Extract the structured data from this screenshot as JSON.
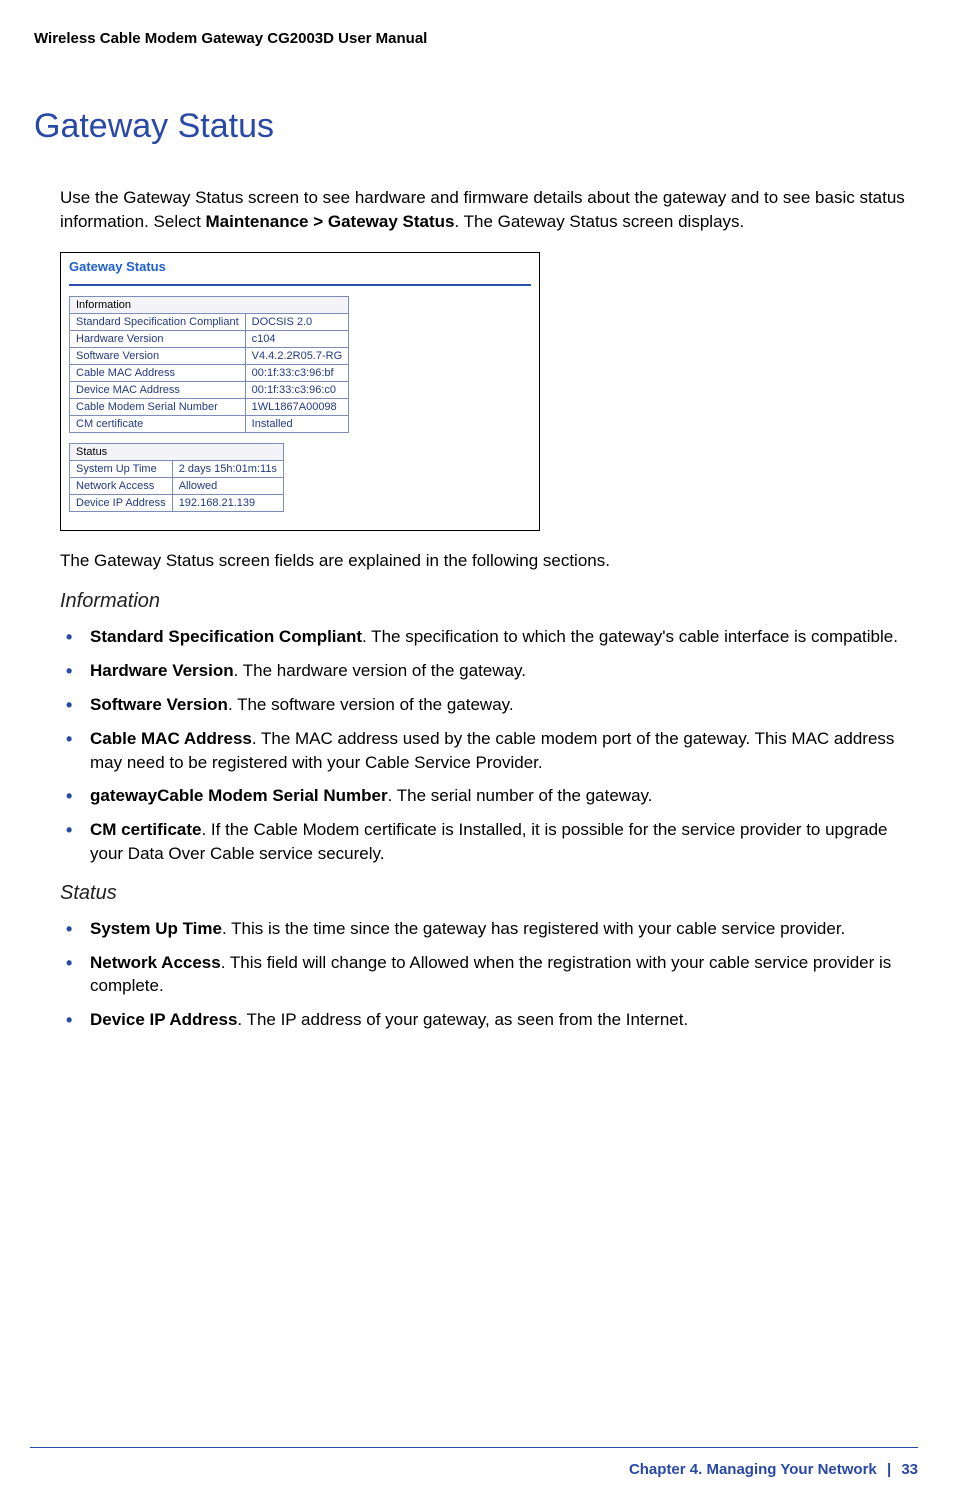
{
  "header": {
    "title": "Wireless Cable Modem Gateway CG2003D User Manual"
  },
  "main": {
    "heading": "Gateway Status",
    "intro_before": "Use the Gateway Status screen to see hardware and firmware details about the gateway and to see basic status information. Select ",
    "intro_bold": "Maintenance > Gateway Status",
    "intro_after": ". The Gateway Status screen displays.",
    "after_screenshot": "The Gateway Status screen fields are explained in the following sections."
  },
  "screenshot": {
    "title": "Gateway Status",
    "information_header": "Information",
    "information_rows": [
      {
        "label": "Standard Specification Compliant",
        "value": "DOCSIS 2.0"
      },
      {
        "label": "Hardware Version",
        "value": "c104"
      },
      {
        "label": "Software Version",
        "value": "V4.4.2.2R05.7-RG"
      },
      {
        "label": "Cable MAC Address",
        "value": "00:1f:33:c3:96:bf"
      },
      {
        "label": "Device MAC Address",
        "value": "00:1f:33:c3:96:c0"
      },
      {
        "label": "Cable Modem Serial Number",
        "value": "1WL1867A00098"
      },
      {
        "label": "CM certificate",
        "value": "Installed"
      }
    ],
    "status_header": "Status",
    "status_rows": [
      {
        "label": "System Up Time",
        "value": "2 days 15h:01m:11s"
      },
      {
        "label": "Network Access",
        "value": "Allowed"
      },
      {
        "label": "Device IP Address",
        "value": "192.168.21.139"
      }
    ]
  },
  "information_section": {
    "heading": "Information",
    "items": [
      {
        "term": "Standard Specification Compliant",
        "desc": ". The specification to which the gateway's cable interface is compatible."
      },
      {
        "term": "Hardware Version",
        "desc": ". The hardware version of the gateway."
      },
      {
        "term": "Software Version",
        "desc": ". The software version of the gateway."
      },
      {
        "term": "Cable MAC Address",
        "desc": ". The MAC address used by the cable modem port of the gateway. This MAC address may need to be registered with your Cable Service Provider."
      },
      {
        "term": "gatewayCable Modem Serial Number",
        "desc": ". The serial number of the gateway."
      },
      {
        "term": "CM certificate",
        "desc": ". If the Cable Modem certificate is Installed, it is possible for the service provider to upgrade your Data Over Cable service securely."
      }
    ]
  },
  "status_section": {
    "heading": "Status",
    "items": [
      {
        "term": "System Up Time",
        "desc": ". This is the time since the gateway has registered with your cable service provider."
      },
      {
        "term": "Network Access",
        "desc": ". This field will change to Allowed when the registration with your cable service provider is complete."
      },
      {
        "term": "Device IP Address",
        "desc": ". The IP address of your gateway, as seen from the Internet."
      }
    ]
  },
  "footer": {
    "chapter": "Chapter 4.  Managing Your Network",
    "page": "33"
  }
}
